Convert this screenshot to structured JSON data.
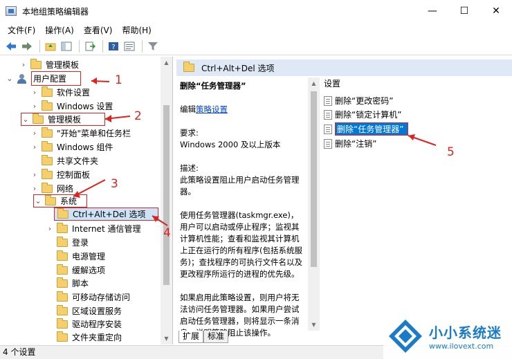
{
  "window": {
    "title": "本地组策略编辑器",
    "minimize": "—",
    "maximize": "☐",
    "close": "✕"
  },
  "menu": [
    {
      "label": "文件(F)"
    },
    {
      "label": "操作(A)"
    },
    {
      "label": "查看(V)"
    },
    {
      "label": "帮助(H)"
    }
  ],
  "tree": {
    "items": [
      {
        "label": "管理模板"
      },
      {
        "label": "用户配置"
      },
      {
        "label": "软件设置"
      },
      {
        "label": "Windows 设置"
      },
      {
        "label": "管理模板"
      },
      {
        "label": "\"开始\"菜单和任务栏"
      },
      {
        "label": "Windows 组件"
      },
      {
        "label": "共享文件夹"
      },
      {
        "label": "控制面板"
      },
      {
        "label": "网络"
      },
      {
        "label": "系统"
      },
      {
        "label": "Ctrl+Alt+Del 选项"
      },
      {
        "label": "Internet 通信管理"
      },
      {
        "label": "登录"
      },
      {
        "label": "电源管理"
      },
      {
        "label": "缓解选项"
      },
      {
        "label": "脚本"
      },
      {
        "label": "可移动存储访问"
      },
      {
        "label": "区域设置服务"
      },
      {
        "label": "驱动程序安装"
      },
      {
        "label": "文件夹重定向"
      }
    ]
  },
  "right": {
    "header": "Ctrl+Alt+Del 选项",
    "desc": {
      "title": "删除“任务管理器”",
      "edit_prefix": "编辑",
      "edit_link": "策略设置",
      "req_label": "要求:",
      "req_value": "Windows 2000 及以上版本",
      "desc_label": "描述:",
      "desc_value": "此策略设置阻止用户启动任务管理器。",
      "para1": "使用任务管理器(taskmgr.exe)，用户可以启动或停止程序；监视其计算机性能；查看和监视其计算机上正在运行的所有程序(包括系统服务)；查找程序的可执行文件名以及更改程序所运行的进程的优先级。",
      "para2": "如果启用此策略设置，则用户将无法访问任务管理器。如果用户尝试启动任务管理器，则将显示一条消息，说明策略阻止该操作。"
    },
    "settings_header": "设置",
    "settings": [
      {
        "label": "删除“更改密码”"
      },
      {
        "label": "删除“锁定计算机”"
      },
      {
        "label": "删除“任务管理器”"
      },
      {
        "label": "删除“注销”"
      }
    ]
  },
  "tabs": [
    {
      "label": "扩展"
    },
    {
      "label": "标准"
    }
  ],
  "status": "4 个设置",
  "annotations": [
    "1",
    "2",
    "3",
    "4",
    "5"
  ],
  "watermark": {
    "name": "小小系统迷",
    "url": "www.ilovext.com"
  }
}
